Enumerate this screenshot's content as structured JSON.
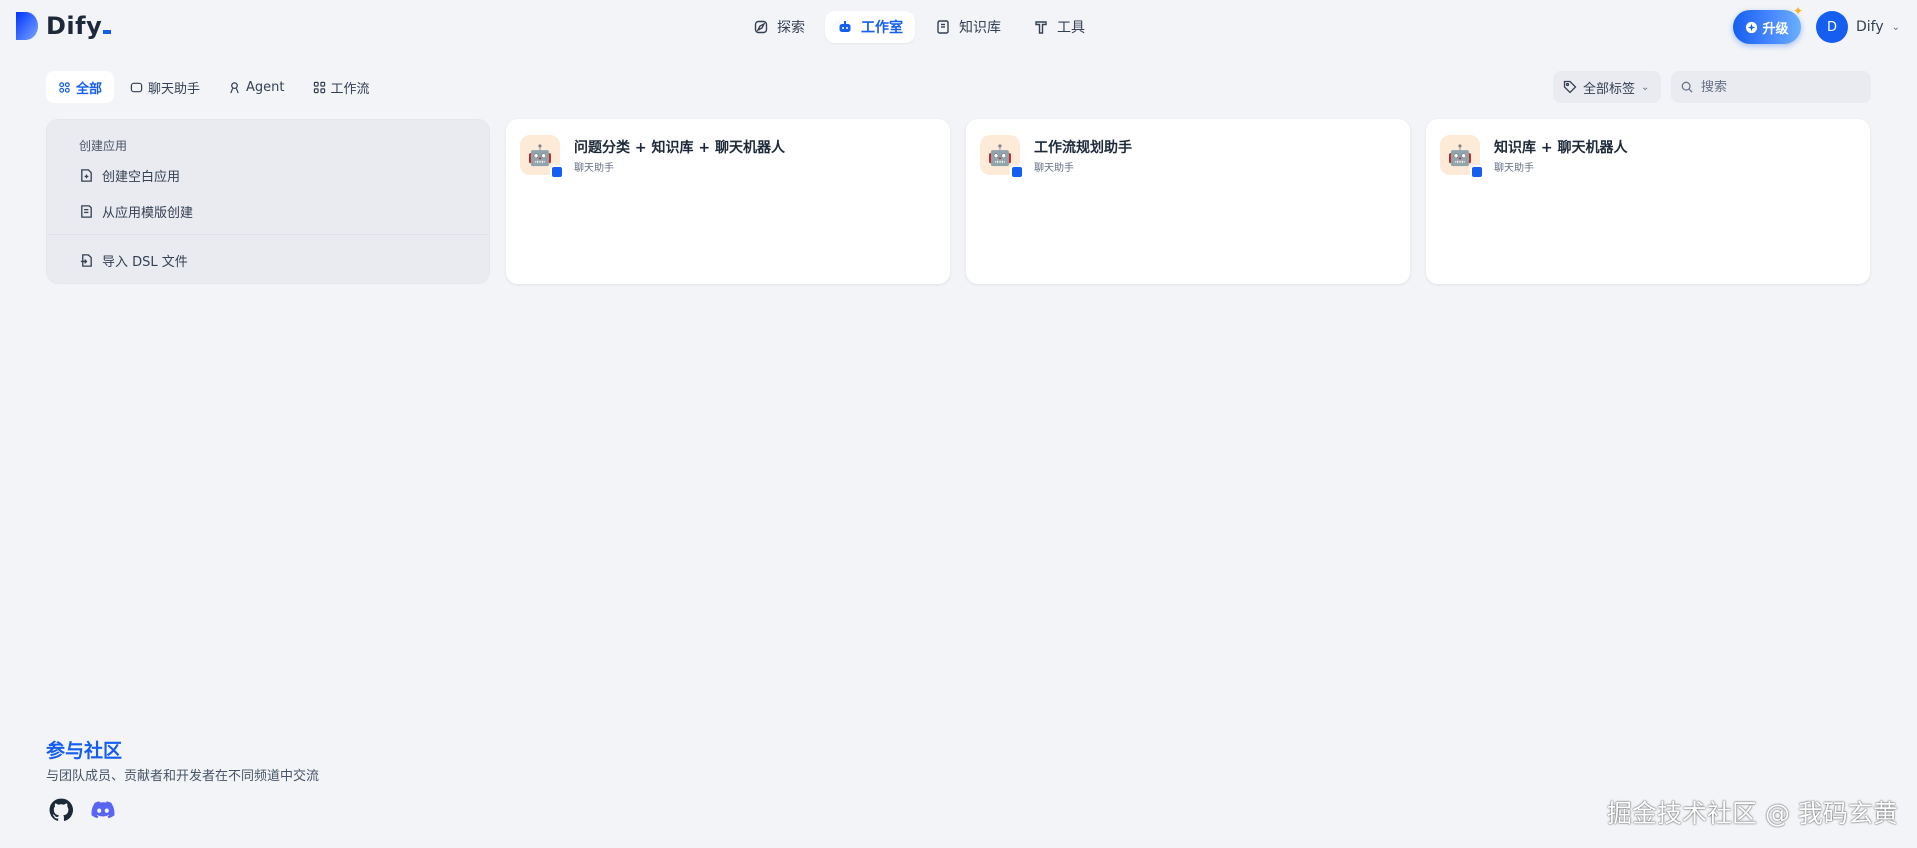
{
  "header": {
    "logo_text": "Dify",
    "nav": [
      {
        "label": "探索",
        "icon": "compass-icon",
        "active": false
      },
      {
        "label": "工作室",
        "icon": "robot-icon",
        "active": true
      },
      {
        "label": "知识库",
        "icon": "book-icon",
        "active": false
      },
      {
        "label": "工具",
        "icon": "tools-icon",
        "active": false
      }
    ],
    "upgrade_label": "升级",
    "user": {
      "avatar_letter": "D",
      "name": "Dify"
    }
  },
  "filters": {
    "tabs": [
      {
        "label": "全部",
        "active": true
      },
      {
        "label": "聊天助手",
        "active": false
      },
      {
        "label": "Agent",
        "active": false
      },
      {
        "label": "工作流",
        "active": false
      }
    ],
    "tag_select_label": "全部标签",
    "search_placeholder": "搜索"
  },
  "create_card": {
    "title": "创建应用",
    "blank_app": "创建空白应用",
    "from_template": "从应用模版创建",
    "import_dsl": "导入 DSL 文件"
  },
  "apps": [
    {
      "name": "问题分类 + 知识库 + 聊天机器人",
      "type": "聊天助手",
      "icon": "robot-emoji-icon"
    },
    {
      "name": "工作流规划助手",
      "type": "聊天助手",
      "icon": "robot-emoji-icon"
    },
    {
      "name": "知识库 + 聊天机器人",
      "type": "聊天助手",
      "icon": "robot-emoji-icon"
    }
  ],
  "footer": {
    "community_title": "参与社区",
    "community_desc": "与团队成员、贡献者和开发者在不同频道中交流",
    "links": [
      "github-icon",
      "discord-icon"
    ]
  },
  "watermark": "掘金技术社区 @ 我码玄黄",
  "colors": {
    "accent": "#155eef",
    "background": "#f2f4f7",
    "app_icon_bg": "#fdebd8"
  }
}
